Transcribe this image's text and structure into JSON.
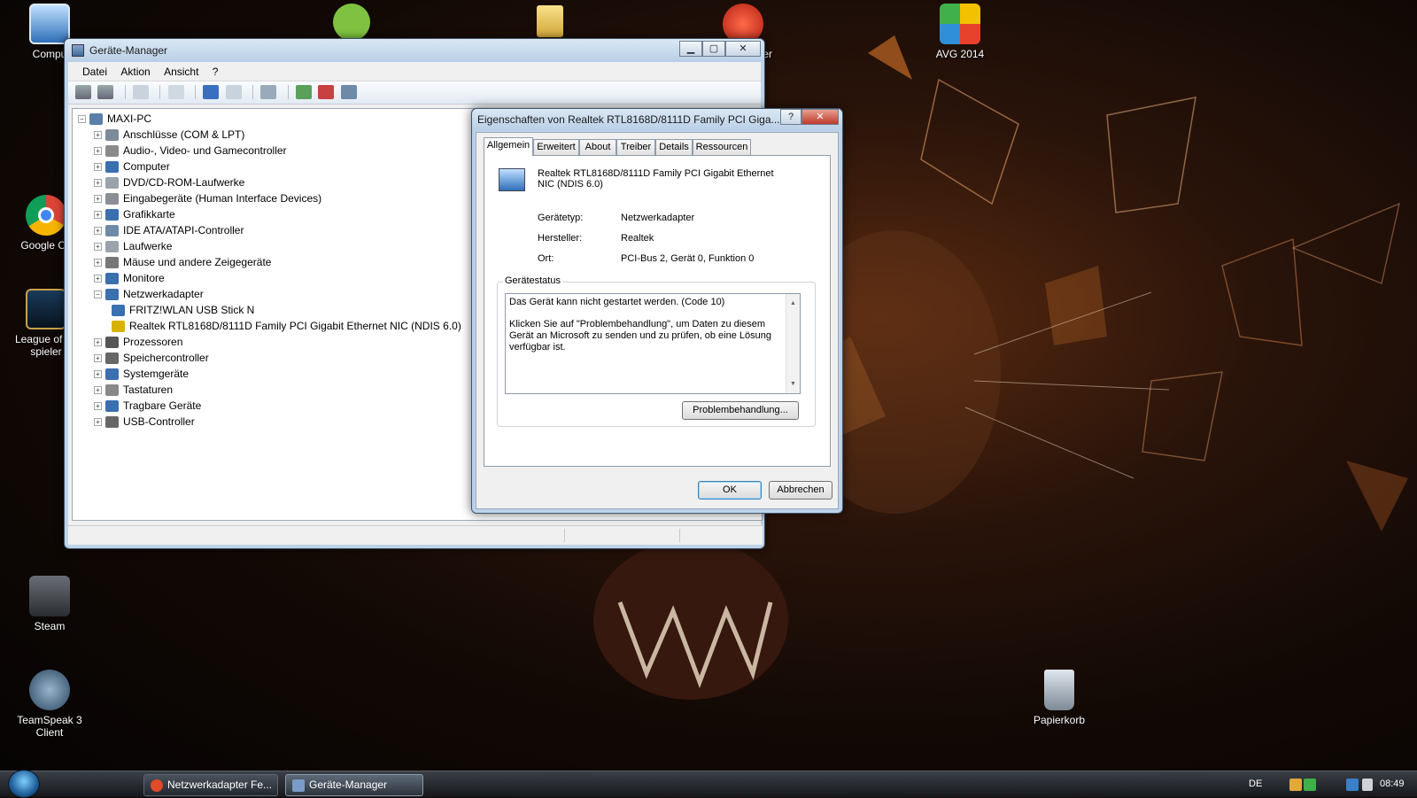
{
  "desktop": {
    "icons": [
      {
        "label": "Compu",
        "name": "computer-desktop-icon"
      },
      {
        "label": "Google Ch",
        "name": "chrome-desktop-icon"
      },
      {
        "label": "League of Le",
        "label2": "spieler",
        "name": "league-desktop-icon"
      },
      {
        "label": "Steam",
        "name": "steam-desktop-icon"
      },
      {
        "label": "TeamSpeak 3 Client",
        "name": "teamspeak-desktop-icon"
      },
      {
        "label": "AVG 2014",
        "name": "avg-desktop-icon"
      },
      {
        "label": "ner",
        "name": "cleaner-desktop-icon"
      },
      {
        "label": "Papierkorb",
        "name": "recycle-bin-desktop-icon"
      }
    ]
  },
  "device_manager": {
    "title": "Geräte-Manager",
    "menu": [
      "Datei",
      "Aktion",
      "Ansicht",
      "?"
    ],
    "root": "MAXI-PC",
    "tree": [
      {
        "label": "Anschlüsse (COM & LPT)",
        "color": "#7d8a99"
      },
      {
        "label": "Audio-, Video- und Gamecontroller",
        "color": "#8a8a8a"
      },
      {
        "label": "Computer",
        "color": "#3a6fb0"
      },
      {
        "label": "DVD/CD-ROM-Laufwerke",
        "color": "#9aa3ad"
      },
      {
        "label": "Eingabegeräte (Human Interface Devices)",
        "color": "#8a8f96"
      },
      {
        "label": "Grafikkarte",
        "color": "#3a6fb0"
      },
      {
        "label": "IDE ATA/ATAPI-Controller",
        "color": "#6f8aa8"
      },
      {
        "label": "Laufwerke",
        "color": "#9aa3ad"
      },
      {
        "label": "Mäuse und andere Zeigegeräte",
        "color": "#777"
      },
      {
        "label": "Monitore",
        "color": "#3a6fb0"
      },
      {
        "label": "Netzwerkadapter",
        "color": "#3a6fb0",
        "expanded": true
      },
      {
        "label": "FRITZ!WLAN USB Stick N",
        "color": "#3a6fb0",
        "child": true
      },
      {
        "label": "Realtek RTL8168D/8111D Family PCI Gigabit Ethernet NIC (NDIS 6.0)",
        "color": "#d9b200",
        "child": true
      },
      {
        "label": "Prozessoren",
        "color": "#555"
      },
      {
        "label": "Speichercontroller",
        "color": "#666"
      },
      {
        "label": "Systemgeräte",
        "color": "#3a6fb0"
      },
      {
        "label": "Tastaturen",
        "color": "#888"
      },
      {
        "label": "Tragbare Geräte",
        "color": "#3a6fb0"
      },
      {
        "label": "USB-Controller",
        "color": "#666"
      }
    ]
  },
  "dialog": {
    "title": "Eigenschaften von Realtek RTL8168D/8111D Family PCI Giga...",
    "help": "?",
    "close": "✕",
    "tabs": [
      "Allgemein",
      "Erweitert",
      "About",
      "Treiber",
      "Details",
      "Ressourcen"
    ],
    "device_name_line1": "Realtek RTL8168D/8111D Family PCI Gigabit Ethernet",
    "device_name_line2": "NIC (NDIS 6.0)",
    "props": [
      {
        "label": "Gerätetyp:",
        "value": "Netzwerkadapter"
      },
      {
        "label": "Hersteller:",
        "value": "Realtek"
      },
      {
        "label": "Ort:",
        "value": "PCI-Bus 2, Gerät 0, Funktion 0"
      }
    ],
    "status_group": "Gerätestatus",
    "status_line1": "Das Gerät kann nicht gestartet werden. (Code 10)",
    "status_line2": "Klicken Sie auf \"Problembehandlung\", um Daten zu diesem Gerät an Microsoft zu senden und zu prüfen, ob eine Lösung verfügbar ist.",
    "troubleshoot": "Problembehandlung...",
    "ok": "OK",
    "cancel": "Abbrechen"
  },
  "taskbar": {
    "tasks": [
      {
        "label": "Netzwerkadapter Fe...",
        "color": "#e04b2a"
      },
      {
        "label": "Geräte-Manager",
        "color": "#7a9cc6"
      }
    ],
    "lang": "DE",
    "clock": "08:49"
  }
}
